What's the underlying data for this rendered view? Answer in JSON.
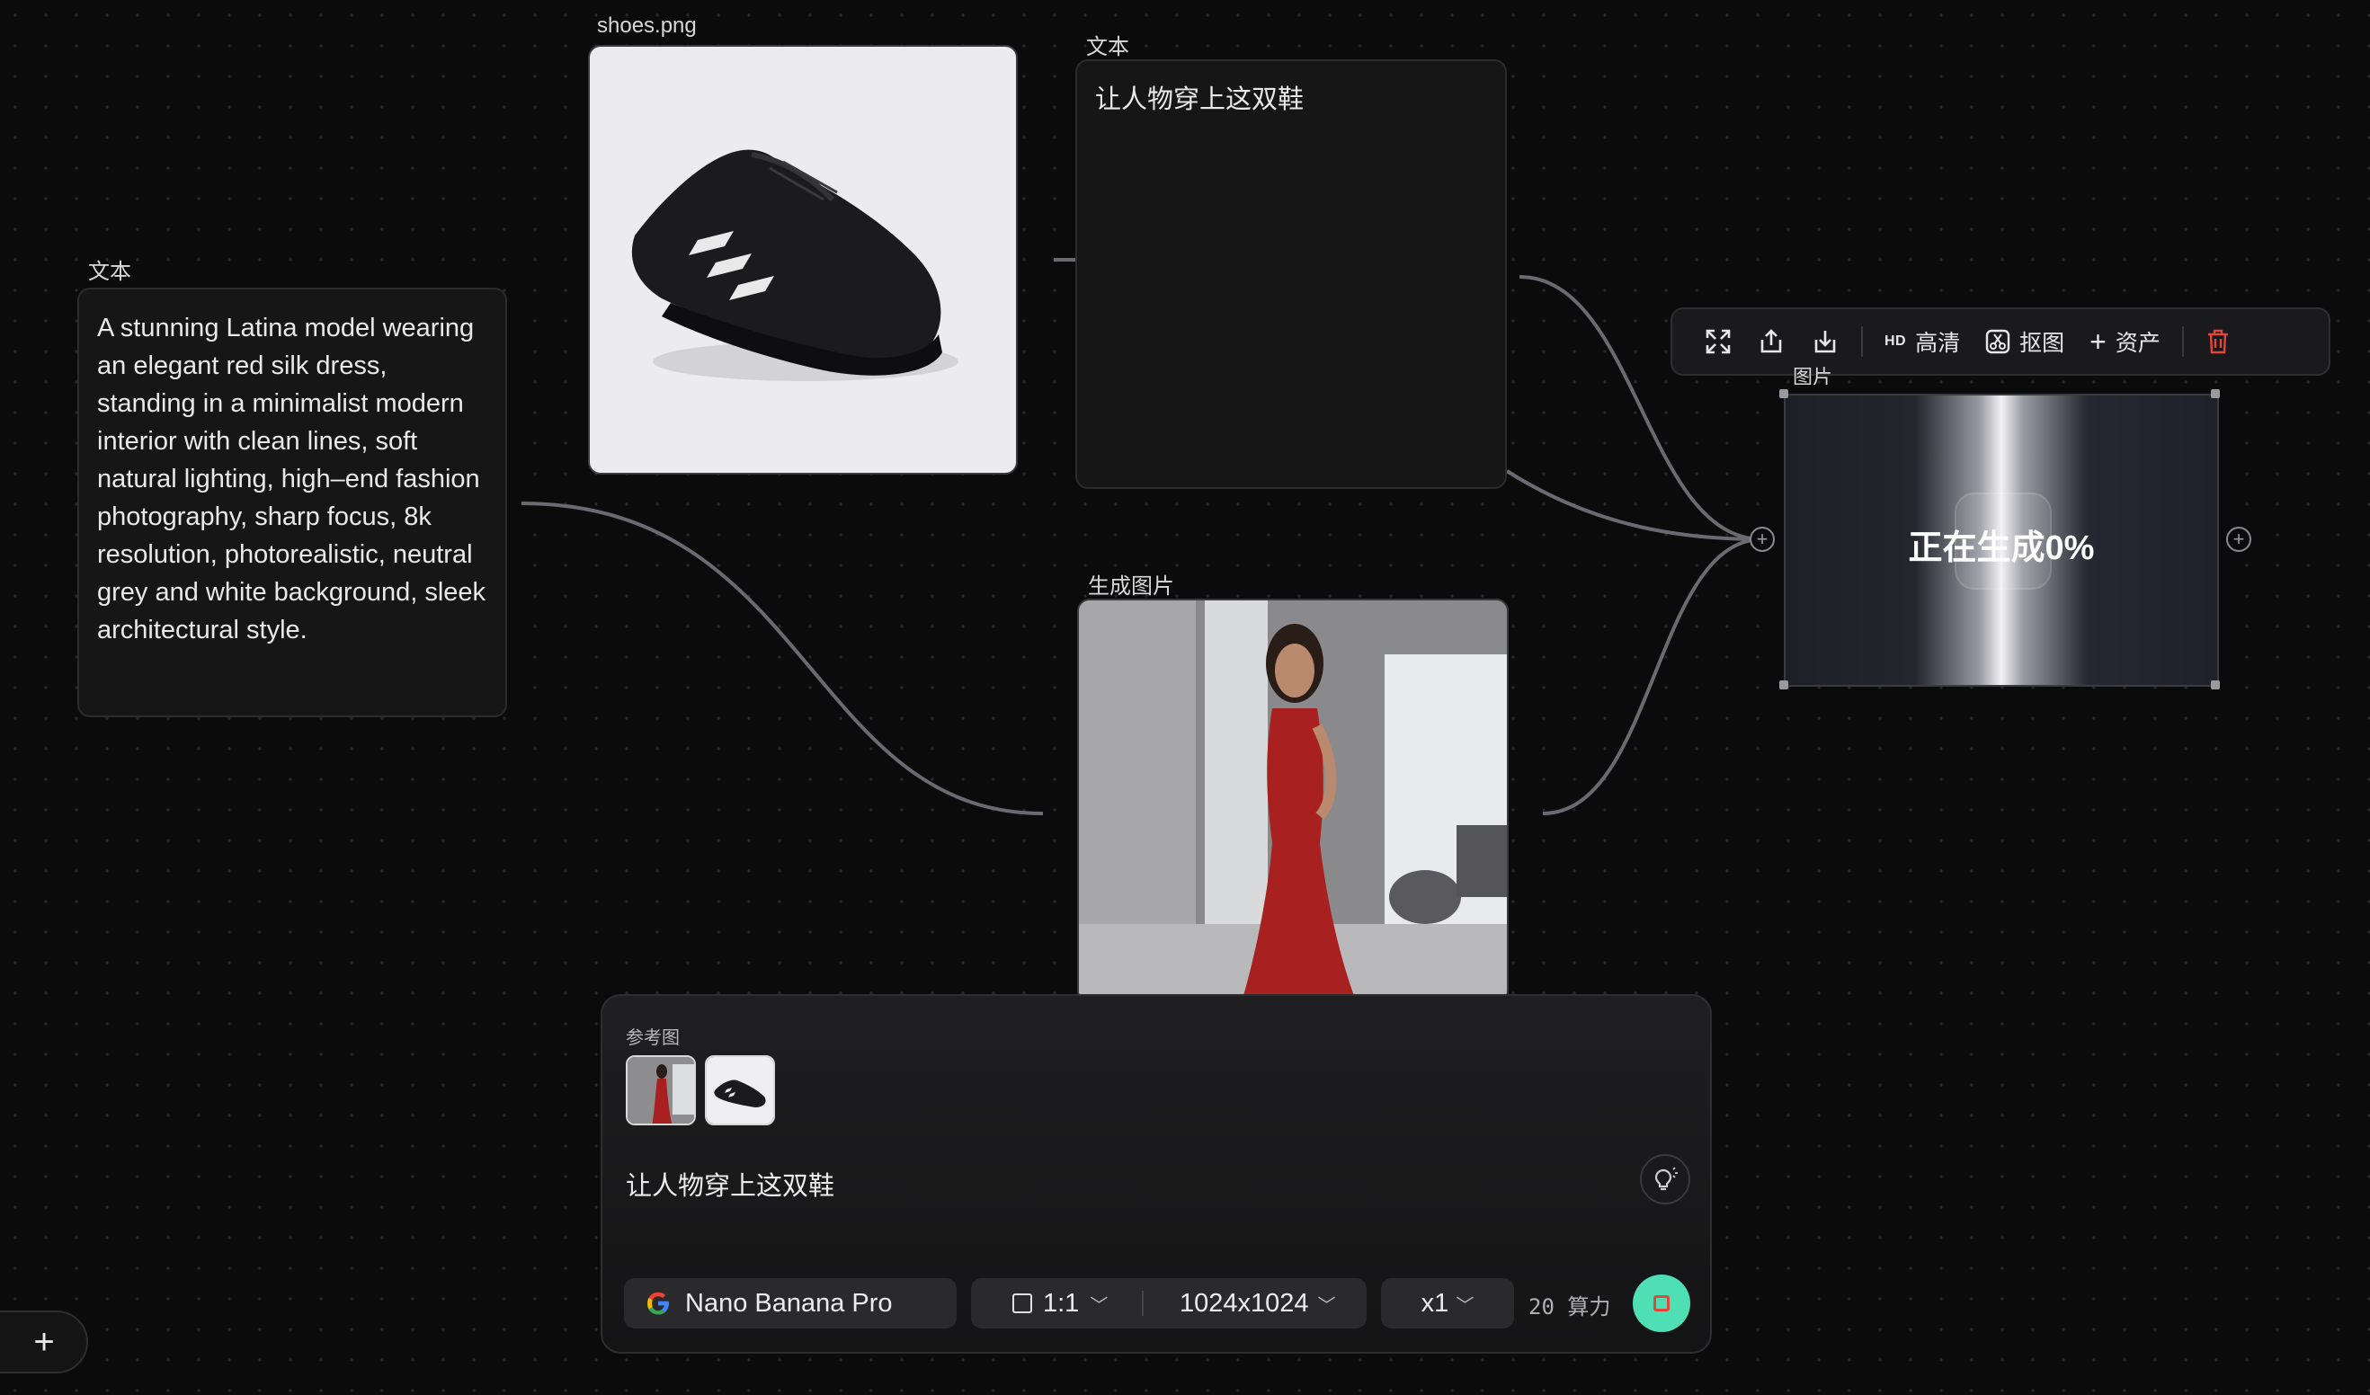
{
  "nodes": {
    "left_text": {
      "label": "文本",
      "content": "A stunning Latina model wearing an elegant red silk dress, standing in a minimalist modern interior with clean lines, soft natural lighting, high–end fashion photography, sharp focus, 8k resolution, photorealistic, neutral grey and white background, sleek architectural style."
    },
    "shoe_image": {
      "label": "shoes.png"
    },
    "top_text": {
      "label": "文本",
      "content": "让人物穿上这双鞋"
    },
    "generated_image": {
      "label": "生成图片"
    },
    "generating_image": {
      "label": "图片",
      "status": "正在生成0%"
    }
  },
  "toolbar": {
    "items": [
      {
        "name": "fullscreen-icon"
      },
      {
        "name": "share-icon"
      },
      {
        "name": "download-icon"
      },
      {
        "badge": "HD",
        "label": "高清"
      },
      {
        "label": "抠图"
      },
      {
        "label": "资产"
      },
      {
        "name": "trash-icon"
      }
    ],
    "hd_badge": "HD",
    "hd_label": "高清",
    "cutout_label": "抠图",
    "asset_label": "资产"
  },
  "panel": {
    "reference_label": "参考图",
    "prompt": "让人物穿上这双鞋",
    "model": "Nano Banana Pro",
    "ratio": "1:1",
    "resolution": "1024x1024",
    "count": "x1",
    "cost": "20 算力"
  },
  "colors": {
    "accent": "#4ee0b4",
    "delete": "#e0463a",
    "background": "#0b0b0c"
  }
}
